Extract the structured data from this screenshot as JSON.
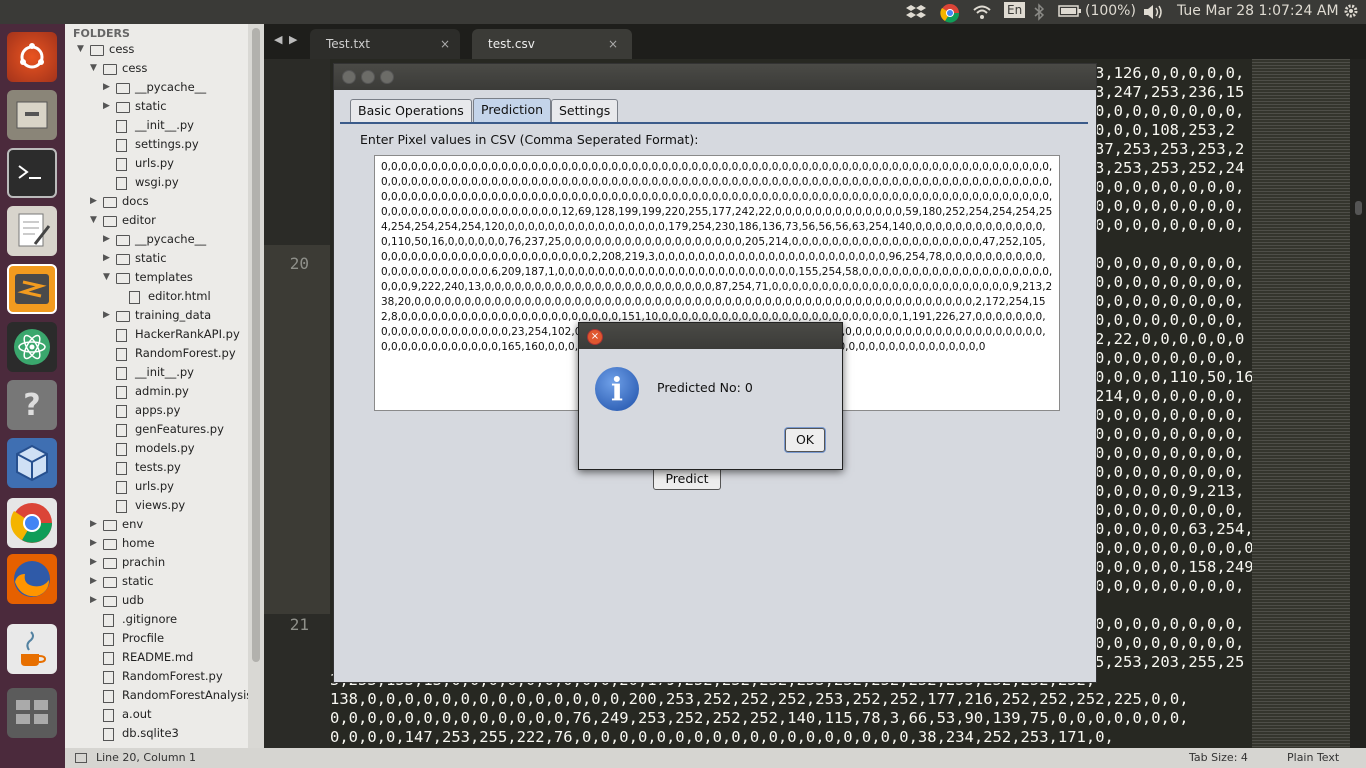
{
  "topbar": {
    "keyboard": "En",
    "battery": "(100%)",
    "clock": "Tue Mar 28  1:07:24 AM"
  },
  "sidebar": {
    "header": "FOLDERS",
    "items": [
      {
        "label": "cess",
        "type": "folder",
        "open": true,
        "depth": 0
      },
      {
        "label": "cess",
        "type": "folder",
        "open": true,
        "depth": 1
      },
      {
        "label": "__pycache__",
        "type": "folder",
        "open": false,
        "depth": 2
      },
      {
        "label": "static",
        "type": "folder",
        "open": false,
        "depth": 2
      },
      {
        "label": "__init__.py",
        "type": "file",
        "depth": 2
      },
      {
        "label": "settings.py",
        "type": "file",
        "depth": 2
      },
      {
        "label": "urls.py",
        "type": "file",
        "depth": 2
      },
      {
        "label": "wsgi.py",
        "type": "file",
        "depth": 2
      },
      {
        "label": "docs",
        "type": "folder",
        "open": false,
        "depth": 1
      },
      {
        "label": "editor",
        "type": "folder",
        "open": true,
        "depth": 1
      },
      {
        "label": "__pycache__",
        "type": "folder",
        "open": false,
        "depth": 2
      },
      {
        "label": "static",
        "type": "folder",
        "open": false,
        "depth": 2
      },
      {
        "label": "templates",
        "type": "folder",
        "open": true,
        "depth": 2
      },
      {
        "label": "editor.html",
        "type": "file",
        "depth": 3
      },
      {
        "label": "training_data",
        "type": "folder",
        "open": false,
        "depth": 2
      },
      {
        "label": "HackerRankAPI.py",
        "type": "file",
        "depth": 2
      },
      {
        "label": "RandomForest.py",
        "type": "file",
        "depth": 2
      },
      {
        "label": "__init__.py",
        "type": "file",
        "depth": 2
      },
      {
        "label": "admin.py",
        "type": "file",
        "depth": 2
      },
      {
        "label": "apps.py",
        "type": "file",
        "depth": 2
      },
      {
        "label": "genFeatures.py",
        "type": "file",
        "depth": 2
      },
      {
        "label": "models.py",
        "type": "file",
        "depth": 2
      },
      {
        "label": "tests.py",
        "type": "file",
        "depth": 2
      },
      {
        "label": "urls.py",
        "type": "file",
        "depth": 2
      },
      {
        "label": "views.py",
        "type": "file",
        "depth": 2
      },
      {
        "label": "env",
        "type": "folder",
        "open": false,
        "depth": 1
      },
      {
        "label": "home",
        "type": "folder",
        "open": false,
        "depth": 1
      },
      {
        "label": "prachin",
        "type": "folder",
        "open": false,
        "depth": 1
      },
      {
        "label": "static",
        "type": "folder",
        "open": false,
        "depth": 1
      },
      {
        "label": "udb",
        "type": "folder",
        "open": false,
        "depth": 1
      },
      {
        "label": ".gitignore",
        "type": "file",
        "depth": 1
      },
      {
        "label": "Procfile",
        "type": "file",
        "depth": 1
      },
      {
        "label": "README.md",
        "type": "file",
        "depth": 1
      },
      {
        "label": "RandomForest.py",
        "type": "file",
        "depth": 1
      },
      {
        "label": "RandomForestAnalysis",
        "type": "file",
        "depth": 1
      },
      {
        "label": "a.out",
        "type": "file",
        "depth": 1
      },
      {
        "label": "db.sqlite3",
        "type": "file",
        "depth": 1
      }
    ]
  },
  "tabs": [
    {
      "label": "Test.txt",
      "close": "×"
    },
    {
      "label": "test.csv",
      "close": "×"
    }
  ],
  "editor": {
    "line_numbers": [
      "20",
      "21"
    ],
    "right_lines": [
      "3,126,0,0,0,0,0,",
      "3,247,253,236,15",
      "0,0,0,0,0,0,0,0,",
      "0,0,0,108,253,2",
      "37,253,253,253,2",
      "3,253,253,252,24",
      "0,0,0,0,0,0,0,0,",
      "0,0,0,0,0,0,0,0,",
      "0,0,0,0,0,0,0,0,",
      "",
      "0,0,0,0,0,0,0,0,",
      "0,0,0,0,0,0,0,0,",
      "0,0,0,0,0,0,0,0,",
      "0,0,0,0,0,0,0,0,",
      "2,22,0,0,0,0,0,0",
      "0,0,0,0,0,0,0,0,",
      "0,0,0,0,110,50,16",
      "214,0,0,0,0,0,0,",
      "0,0,0,0,0,0,0,0,",
      "0,0,0,0,0,0,0,0,",
      "0,0,0,0,0,0,0,0,",
      "0,0,0,0,0,0,0,0,",
      "0,0,0,0,0,9,213,",
      "0,0,0,0,0,0,0,0,",
      "0,0,0,0,0,63,254,1",
      "0,0,0,0,0,0,0,0,0",
      "0,0,0,0,0,158,249,47",
      "0,0,0,0,0,0,0,0,",
      "",
      "0,0,0,0,0,0,0,0,",
      "0,0,0,0,0,0,0,0,",
      "5,253,203,255,25"
    ],
    "bottom_lines": [
      "3,253,153,13,0,0,0,0,0,0,0,0,0,20,179,252,252,252,253,252,252,252,253,252,252,252,",
      "138,0,0,0,0,0,0,0,0,0,0,0,0,0,0,200,253,252,252,252,253,252,252,177,216,252,252,252,225,0,0,",
      "0,0,0,0,0,0,0,0,0,0,0,0,0,76,249,253,252,252,252,140,115,78,3,66,53,90,139,75,0,0,0,0,0,0,0,",
      "0,0,0,0,147,253,255,222,76,0,0,0,0,0,0,0,0,0,0,0,0,0,0,0,0,0,0,38,234,252,253,171,0,"
    ]
  },
  "status": {
    "position": "Line 20, Column 1",
    "tab_size": "Tab Size: 4",
    "syntax": "Plain Text"
  },
  "java_app": {
    "tabs": [
      "Basic Operations",
      "Prediction",
      "Settings"
    ],
    "prompt": "Enter Pixel values in CSV (Comma Seperated Format):",
    "csv_text": "0,0,0,0,0,0,0,0,0,0,0,0,0,0,0,0,0,0,0,0,0,0,0,0,0,0,0,0,0,0,0,0,0,0,0,0,0,0,0,0,0,0,0,0,0,0,0,0,0,0,0,0,0,0,0,0,0,0,0,0,0,0,0,0,0,0,0,0,0,0,0,0,0,0,0,0,0,0,0,0,0,0,0,0,0,0,0,0,0,0,0,0,0,0,0,0,0,0,0,0,0,0,0,0,0,0,0,0,0,0,0,0,0,0,0,0,0,0,0,0,0,0,0,0,0,0,0,0,0,0,0,0,0,0,0,0,0,0,0,0,0,0,0,0,0,0,0,0,0,0,0,0,0,0,0,0,0,0,0,0,0,0,0,0,0,0,0,0,0,0,0,0,0,0,0,0,0,0,0,0,0,0,0,0,0,0,0,0,0,0,0,0,0,0,0,0,0,0,0,0,0,0,0,0,0,0,0,0,0,0,0,0,0,0,0,0,0,0,0,12,69,128,199,199,220,255,177,242,22,0,0,0,0,0,0,0,0,0,0,0,0,0,59,180,252,254,254,254,254,254,254,254,254,120,0,0,0,0,0,0,0,0,0,0,0,0,0,0,0,0,179,254,230,186,136,73,56,56,56,63,254,140,0,0,0,0,0,0,0,0,0,0,0,0,0,0,110,50,16,0,0,0,0,0,0,76,237,25,0,0,0,0,0,0,0,0,0,0,0,0,0,0,0,0,0,0,205,214,0,0,0,0,0,0,0,0,0,0,0,0,0,0,0,0,0,0,0,47,252,105,0,0,0,0,0,0,0,0,0,0,0,0,0,0,0,0,0,0,0,0,0,2,208,219,3,0,0,0,0,0,0,0,0,0,0,0,0,0,0,0,0,0,0,0,0,0,0,0,96,254,78,0,0,0,0,0,0,0,0,0,0,0,0,0,0,0,0,0,0,0,0,0,6,209,187,1,0,0,0,0,0,0,0,0,0,0,0,0,0,0,0,0,0,0,0,0,0,0,0,0,155,254,58,0,0,0,0,0,0,0,0,0,0,0,0,0,0,0,0,0,0,0,0,0,0,9,222,240,13,0,0,0,0,0,0,0,0,0,0,0,0,0,0,0,0,0,0,0,0,0,0,0,87,254,71,0,0,0,0,0,0,0,0,0,0,0,0,0,0,0,0,0,0,0,0,0,0,0,0,9,213,238,20,0,0,0,0,0,0,0,0,0,0,0,0,0,0,0,0,0,0,0,0,0,0,0,0,0,0,0,0,0,0,0,0,0,0,0,0,0,0,0,0,0,0,0,0,0,0,0,0,0,0,0,0,0,0,0,0,2,172,254,152,8,0,0,0,0,0,0,0,0,0,0,0,0,0,0,0,0,0,0,0,0,0,0,151,10,0,0,0,0,0,0,0,0,0,0,0,0,0,0,0,0,0,0,0,0,0,0,0,0,1,191,226,27,0,0,0,0,0,0,0,0,0,0,0,0,0,0,0,0,0,0,0,0,23,254,102,0,0,0,0,0,0,0,0,0,0,0,0,0,0,0,0,0,0,0,0,0,0,0,0,0,0,0,0,0,0,0,0,0,0,0,0,0,0,0,0,0,0,0,0,0,0,0,0,0,0,0,0,0,0,0,0,0,0,0,165,160,0,0,0,0,0,0,0,0,0,0,0,0,0,0,0,0,0,0,0,0,0,0,0,0,0,0,0,0,0,0,0,0,0,0,0,0,0,0,0,0,0,0,0,0",
    "predict_button": "Predict"
  },
  "dialog": {
    "message": "Predicted No: 0",
    "ok_button": "OK"
  }
}
